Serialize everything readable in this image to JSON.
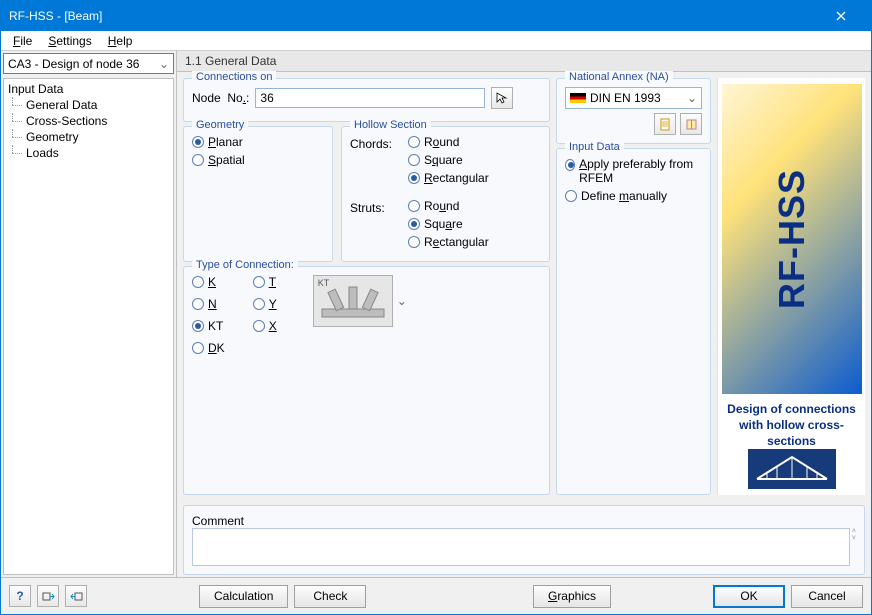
{
  "window": {
    "title": "RF-HSS - [Beam]"
  },
  "menu": {
    "file": "File",
    "settings": "Settings",
    "help": "Help"
  },
  "case_selector": "CA3 - Design of node 36",
  "tree": {
    "root": "Input Data",
    "items": [
      "General Data",
      "Cross-Sections",
      "Geometry",
      "Loads"
    ]
  },
  "panel_title": "1.1 General Data",
  "connections_on": {
    "legend": "Connections on",
    "node_label": "Node  No.:",
    "node_value": "36"
  },
  "geometry": {
    "legend": "Geometry",
    "planar": "Planar",
    "spatial": "Spatial"
  },
  "hollow": {
    "legend": "Hollow Section",
    "chords_label": "Chords:",
    "struts_label": "Struts:",
    "round": "Round",
    "square": "Square",
    "rect": "Rectangular"
  },
  "type_conn": {
    "legend": "Type of Connection:",
    "k": "K",
    "t": "T",
    "n": "N",
    "y": "Y",
    "kt": "KT",
    "x": "X",
    "dk": "DK",
    "preview_label": "KT"
  },
  "comment_legend": "Comment",
  "na": {
    "legend": "National Annex (NA)",
    "value": "DIN EN 1993"
  },
  "input_data": {
    "legend": "Input Data",
    "apply": "Apply preferably from RFEM",
    "define": "Define manually"
  },
  "brand": {
    "name": "RF-HSS",
    "desc1": "Design of connections",
    "desc2": "with hollow cross-sections"
  },
  "footer": {
    "calculation": "Calculation",
    "check": "Check",
    "graphics": "Graphics",
    "ok": "OK",
    "cancel": "Cancel"
  }
}
